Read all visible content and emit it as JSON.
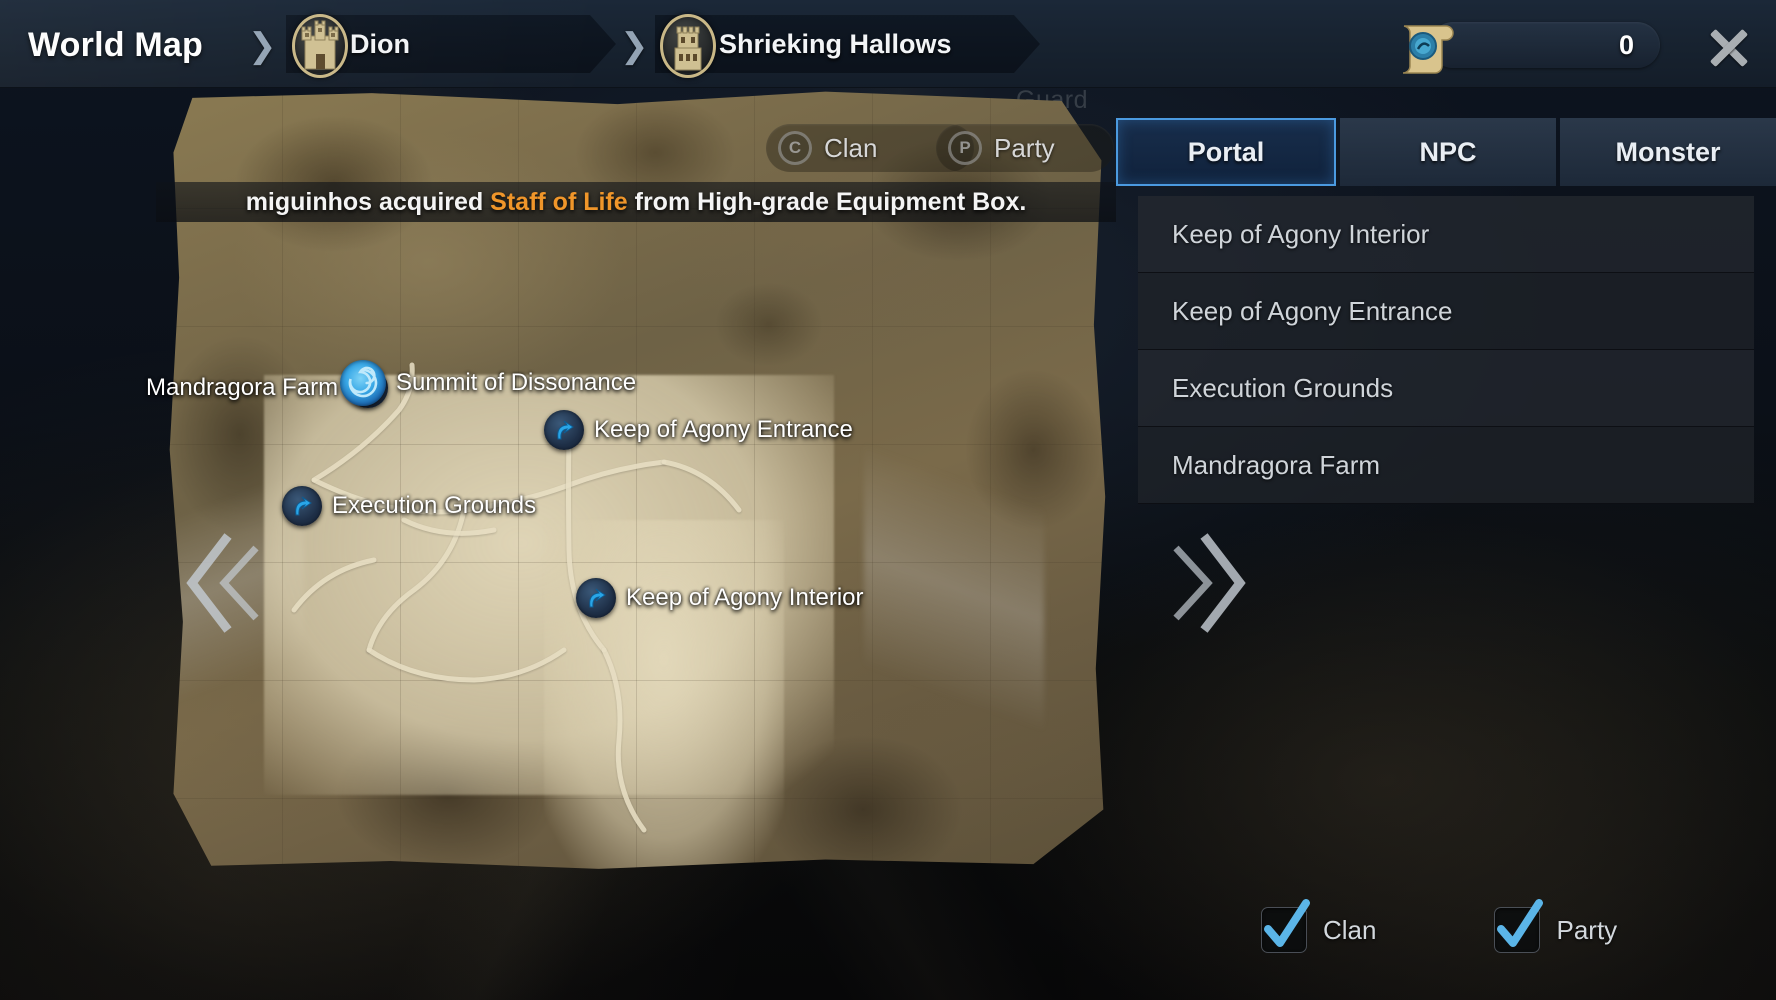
{
  "header": {
    "title": "World Map",
    "breadcrumbs": [
      {
        "label": "Dion",
        "icon": "castle-medallion-icon"
      },
      {
        "label": "Shrieking Hallows",
        "icon": "tower-medallion-icon"
      }
    ],
    "token": {
      "icon": "scroll-teleport-icon",
      "count": "0"
    },
    "close_icon": "close-icon"
  },
  "background": {
    "guard_label": "Guard"
  },
  "map": {
    "overlay_pills": [
      {
        "badge": "C",
        "label": "Clan",
        "icon": "clan-badge-icon"
      },
      {
        "badge": "P",
        "label": "Party",
        "icon": "party-badge-icon"
      }
    ],
    "notification": {
      "prefix": "miguinhos acquired ",
      "item": "Staff of Life",
      "suffix": " from High-grade Equipment Box.",
      "item_color": "#f0962a"
    },
    "nav_prev_icon": "chevron-double-left-icon",
    "nav_next_icon": "chevron-double-right-icon",
    "markers": [
      {
        "label": "Mandragora Farm",
        "side": "left",
        "icon": "portal-arrow-icon"
      },
      {
        "label": "Summit of Dissonance",
        "side": "right",
        "icon": "portal-swirl-icon"
      },
      {
        "label": "Keep of Agony Entrance",
        "side": "right",
        "icon": "portal-arrow-icon"
      },
      {
        "label": "Execution Grounds",
        "side": "right",
        "icon": "portal-arrow-icon"
      },
      {
        "label": "Keep of Agony Interior",
        "side": "right",
        "icon": "portal-arrow-icon"
      }
    ]
  },
  "panel": {
    "tabs": [
      {
        "label": "Portal",
        "active": true
      },
      {
        "label": "NPC",
        "active": false
      },
      {
        "label": "Monster",
        "active": false
      }
    ],
    "active_tab_color": "#4b9ae0",
    "list": [
      {
        "label": "Keep of Agony Interior"
      },
      {
        "label": "Keep of Agony Entrance"
      },
      {
        "label": "Execution Grounds"
      },
      {
        "label": "Mandragora Farm"
      }
    ],
    "filters": [
      {
        "label": "Clan",
        "checked": true
      },
      {
        "label": "Party",
        "checked": true
      }
    ],
    "check_color": "#5bb5e8"
  }
}
